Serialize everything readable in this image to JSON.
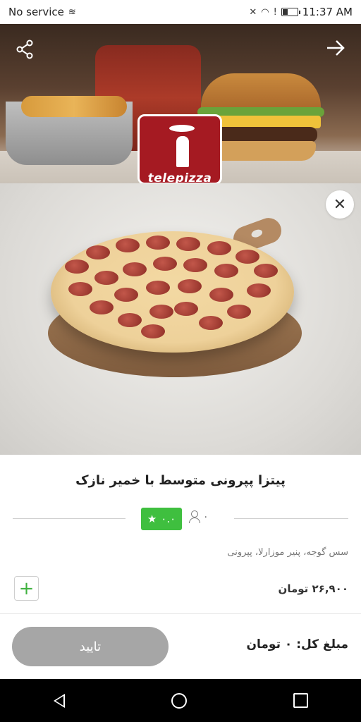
{
  "status_bar": {
    "carrier": "No service",
    "time": "11:37 AM",
    "battery_level": 0.35
  },
  "header": {
    "logo_text": "telepizza"
  },
  "product": {
    "title": "پیتزا پپرونی متوسط با خمیر نازک",
    "rating": "۰.۰",
    "reviews_count": "۰",
    "ingredients": "سس گوجه، پنیر موزارلا، پپرونی",
    "price": "۲۶,۹۰۰ تومان"
  },
  "footer": {
    "total_label": "مبلغ کل: ۰ تومان",
    "confirm_label": "تایید"
  },
  "colors": {
    "accent_green": "#3fbf3f",
    "confirm_gray": "#a6a6a6",
    "logo_red": "#a51a22"
  },
  "icons": [
    "signal-icon",
    "wifi-icon",
    "battery-icon",
    "share-icon",
    "forward-arrow-icon",
    "close-icon",
    "star-icon",
    "user-icon",
    "plus-icon",
    "nav-back-icon",
    "nav-home-icon",
    "nav-recent-icon"
  ]
}
